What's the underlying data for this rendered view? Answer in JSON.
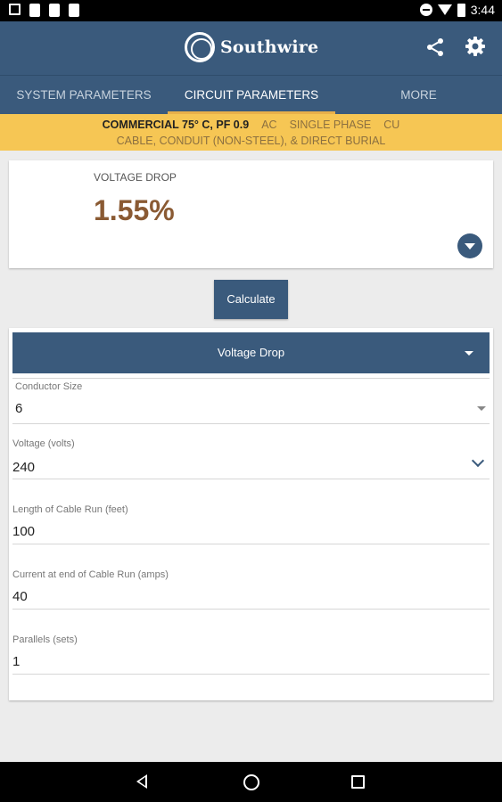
{
  "status_bar": {
    "time": "3:44"
  },
  "app_bar": {
    "brand": "Southwire"
  },
  "tabs": [
    {
      "label": "SYSTEM PARAMETERS"
    },
    {
      "label": "CIRCUIT PARAMETERS"
    },
    {
      "label": "MORE"
    }
  ],
  "banner": {
    "standard": "COMMERCIAL 75° C, PF 0.9",
    "current_type": "AC",
    "phase": "SINGLE PHASE",
    "material": "CU",
    "installation": "CABLE, CONDUIT (NON-STEEL), & DIRECT BURIAL"
  },
  "result": {
    "label": "VOLTAGE DROP",
    "value": "1.55%"
  },
  "calculate_label": "Calculate",
  "calculation_type": "Voltage Drop",
  "fields": {
    "conductor_size": {
      "label": "Conductor Size",
      "value": "6"
    },
    "voltage": {
      "label": "Voltage (volts)",
      "value": "240"
    },
    "length": {
      "label": "Length of Cable Run (feet)",
      "value": "100"
    },
    "current": {
      "label": "Current at end of Cable Run (amps)",
      "value": "40"
    },
    "parallels": {
      "label": "Parallels (sets)",
      "value": "1"
    }
  },
  "colors": {
    "primary": "#3a5a7c",
    "banner": "#f6c654",
    "result_value": "#8a5a33",
    "tab_indicator": "#e8b04a"
  }
}
